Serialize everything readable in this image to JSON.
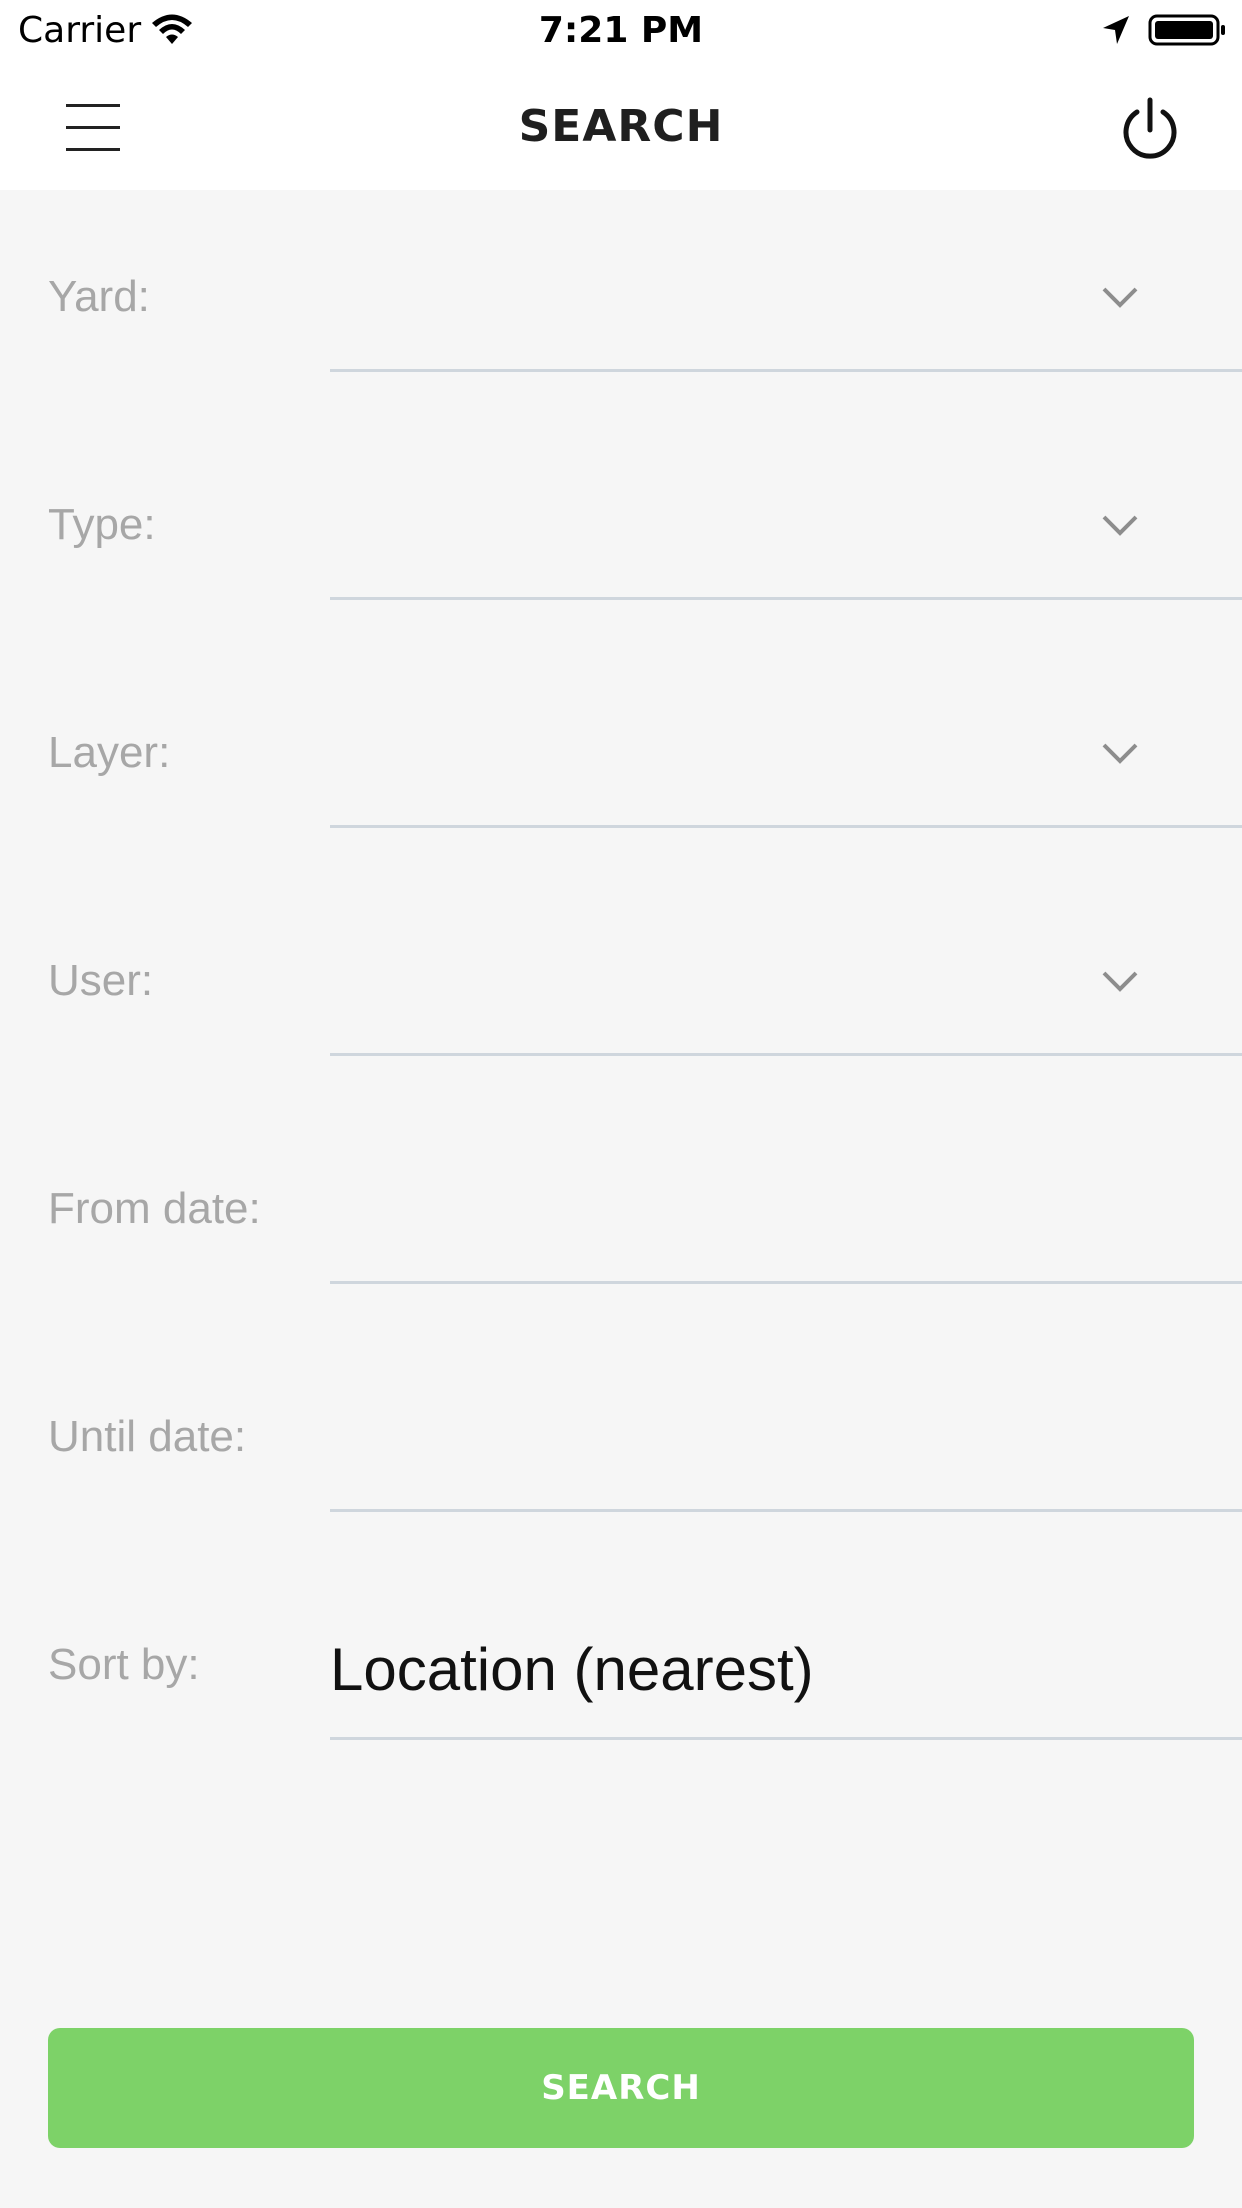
{
  "status_bar": {
    "carrier": "Carrier",
    "time": "7:21 PM",
    "icons": [
      "wifi-icon",
      "location-arrow-icon",
      "battery-icon"
    ]
  },
  "nav": {
    "title": "SEARCH",
    "left_icon": "menu-icon",
    "right_icon": "power-icon"
  },
  "form": {
    "fields": [
      {
        "label": "Yard:",
        "value": "",
        "type": "dropdown"
      },
      {
        "label": "Type:",
        "value": "",
        "type": "dropdown"
      },
      {
        "label": "Layer:",
        "value": "",
        "type": "dropdown"
      },
      {
        "label": "User:",
        "value": "",
        "type": "dropdown"
      },
      {
        "label": "From date:",
        "value": "",
        "type": "date"
      },
      {
        "label": "Until date:",
        "value": "",
        "type": "date"
      },
      {
        "label": "Sort by:",
        "value": "Location (nearest)",
        "type": "select"
      }
    ]
  },
  "search_button": {
    "label": "SEARCH"
  },
  "colors": {
    "background": "#f6f6f6",
    "bar": "#ffffff",
    "label": "#a7a7a7",
    "underline": "#cfd6dd",
    "accent": "#7dd268"
  }
}
